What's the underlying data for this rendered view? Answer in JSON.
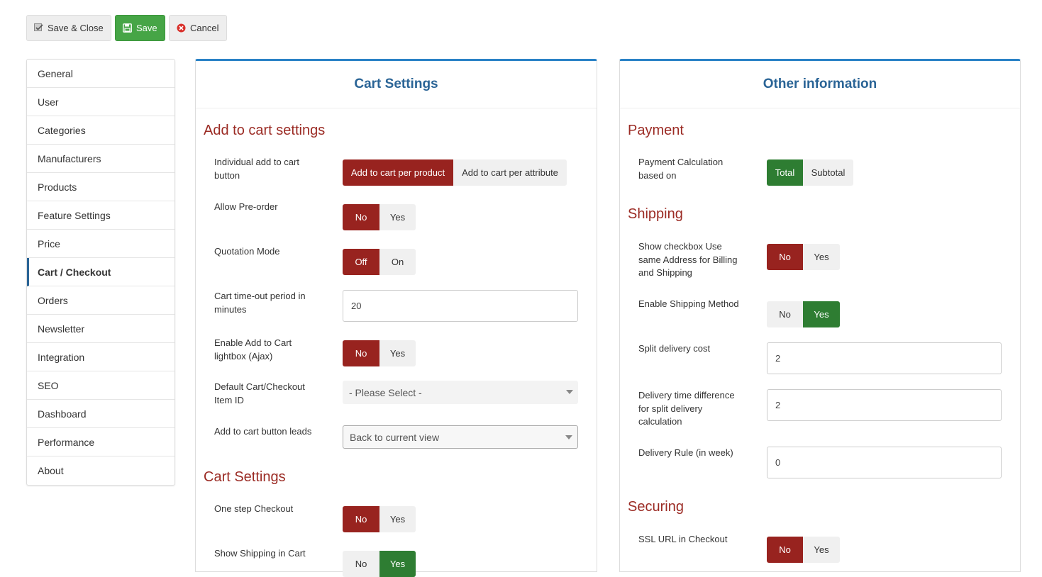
{
  "toolbar": {
    "save_close_label": "Save & Close",
    "save_label": "Save",
    "cancel_label": "Cancel"
  },
  "sidebar": {
    "items": [
      {
        "label": "General"
      },
      {
        "label": "User"
      },
      {
        "label": "Categories"
      },
      {
        "label": "Manufacturers"
      },
      {
        "label": "Products"
      },
      {
        "label": "Feature Settings"
      },
      {
        "label": "Price"
      },
      {
        "label": "Cart / Checkout"
      },
      {
        "label": "Orders"
      },
      {
        "label": "Newsletter"
      },
      {
        "label": "Integration"
      },
      {
        "label": "SEO"
      },
      {
        "label": "Dashboard"
      },
      {
        "label": "Performance"
      },
      {
        "label": "About"
      }
    ],
    "active": "Cart / Checkout"
  },
  "cart_panel": {
    "title": "Cart Settings",
    "section_add": "Add to cart settings",
    "individual_label": "Individual add to cart button",
    "individual_options": [
      "Add to cart per product",
      "Add to cart per attribute"
    ],
    "individual_selected": "Add to cart per product",
    "preorder_label": "Allow Pre-order",
    "preorder_options": [
      "No",
      "Yes"
    ],
    "preorder_selected": "No",
    "quotation_label": "Quotation Mode",
    "quotation_options": [
      "Off",
      "On"
    ],
    "quotation_selected": "Off",
    "timeout_label": "Cart time-out period in minutes",
    "timeout_value": "20",
    "lightbox_label": "Enable Add to Cart lightbox (Ajax)",
    "lightbox_options": [
      "No",
      "Yes"
    ],
    "lightbox_selected": "No",
    "default_item_label": "Default Cart/Checkout Item ID",
    "default_item_value": "- Please Select -",
    "leads_label": "Add to cart button leads",
    "leads_value": "Back to current view",
    "section_cart": "Cart Settings",
    "onestep_label": "One step Checkout",
    "onestep_options": [
      "No",
      "Yes"
    ],
    "onestep_selected": "No",
    "shipping_cart_label": "Show Shipping in Cart",
    "shipping_cart_options": [
      "No",
      "Yes"
    ],
    "shipping_cart_selected": "Yes"
  },
  "other_panel": {
    "title": "Other information",
    "section_payment": "Payment",
    "payment_calc_label": "Payment Calculation based on",
    "payment_calc_options": [
      "Total",
      "Subtotal"
    ],
    "payment_calc_selected": "Total",
    "section_shipping": "Shipping",
    "same_address_label": "Show checkbox Use same Address for Billing and Shipping",
    "same_address_options": [
      "No",
      "Yes"
    ],
    "same_address_selected": "No",
    "ship_method_label": "Enable Shipping Method",
    "ship_method_options": [
      "No",
      "Yes"
    ],
    "ship_method_selected": "Yes",
    "split_cost_label": "Split delivery cost",
    "split_cost_value": "2",
    "delivery_diff_label": "Delivery time difference for split delivery calculation",
    "delivery_diff_value": "2",
    "delivery_rule_label": "Delivery Rule (in week)",
    "delivery_rule_value": "0",
    "section_securing": "Securing",
    "ssl_label": "SSL URL in Checkout",
    "ssl_options": [
      "No",
      "Yes"
    ],
    "ssl_selected": "No"
  },
  "colors": {
    "accent_blue": "#2a6496",
    "panel_top_border": "#2a82c6",
    "section_red": "#9b2b24",
    "active_red": "#98231f",
    "active_green": "#2e7d32",
    "save_green": "#46a546"
  }
}
